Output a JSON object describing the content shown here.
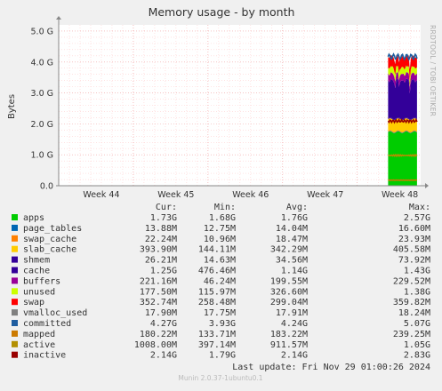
{
  "chart_data": {
    "type": "area",
    "title": "Memory usage - by month",
    "ylabel": "Bytes",
    "side_label": "RRDTOOL / TOBI OETIKER",
    "ylim": [
      0,
      5.2
    ],
    "y_ticks": [
      {
        "value": 0,
        "label": "0.0"
      },
      {
        "value": 1,
        "label": "1.0 G"
      },
      {
        "value": 2,
        "label": "2.0 G"
      },
      {
        "value": 3,
        "label": "3.0 G"
      },
      {
        "value": 4,
        "label": "4.0 G"
      },
      {
        "value": 5,
        "label": "5.0 G"
      }
    ],
    "x_ticks": [
      "Week 44",
      "Week 45",
      "Week 46",
      "Week 47",
      "Week 48"
    ],
    "grid": true,
    "data_window_fraction": [
      0.91,
      0.99
    ],
    "stack_avg_gb": [
      {
        "name": "apps",
        "value": 1.73
      },
      {
        "name": "page_tables",
        "value": 0.014
      },
      {
        "name": "swap_cache",
        "value": 0.022
      },
      {
        "name": "slab_cache",
        "value": 0.385
      },
      {
        "name": "shmem",
        "value": 0.026
      },
      {
        "name": "cache",
        "value": 1.25
      },
      {
        "name": "buffers",
        "value": 0.216
      },
      {
        "name": "unused",
        "value": 0.173
      },
      {
        "name": "swap",
        "value": 0.345
      },
      {
        "name": "vmalloc_used",
        "value": 0.017
      }
    ],
    "line_levels_gb": [
      {
        "name": "committed",
        "value": 4.17
      },
      {
        "name": "mapped",
        "value": 0.18
      },
      {
        "name": "active",
        "value": 0.98
      },
      {
        "name": "inactive",
        "value": 2.09
      }
    ],
    "legend_headers": [
      "Cur:",
      "Min:",
      "Avg:",
      "Max:"
    ],
    "series": [
      {
        "name": "apps",
        "color": "#00cc00",
        "cur": "1.73G",
        "min": "1.68G",
        "avg": "1.76G",
        "max": "2.57G"
      },
      {
        "name": "page_tables",
        "color": "#0066b3",
        "cur": "13.88M",
        "min": "12.75M",
        "avg": "14.04M",
        "max": "16.60M"
      },
      {
        "name": "swap_cache",
        "color": "#ff8000",
        "cur": "22.24M",
        "min": "10.96M",
        "avg": "18.47M",
        "max": "23.93M"
      },
      {
        "name": "slab_cache",
        "color": "#ffcc00",
        "cur": "393.90M",
        "min": "144.11M",
        "avg": "342.29M",
        "max": "405.58M"
      },
      {
        "name": "shmem",
        "color": "#330099",
        "cur": "26.21M",
        "min": "14.63M",
        "avg": "34.56M",
        "max": "73.92M"
      },
      {
        "name": "cache",
        "color": "#330099",
        "cur": "1.25G",
        "min": "476.46M",
        "avg": "1.14G",
        "max": "1.43G"
      },
      {
        "name": "buffers",
        "color": "#990099",
        "cur": "221.16M",
        "min": "46.24M",
        "avg": "199.55M",
        "max": "229.52M"
      },
      {
        "name": "unused",
        "color": "#ccff00",
        "cur": "177.50M",
        "min": "115.97M",
        "avg": "326.60M",
        "max": "1.38G"
      },
      {
        "name": "swap",
        "color": "#ff0000",
        "cur": "352.74M",
        "min": "258.48M",
        "avg": "299.04M",
        "max": "359.82M"
      },
      {
        "name": "vmalloc_used",
        "color": "#808080",
        "cur": "17.90M",
        "min": "17.75M",
        "avg": "17.91M",
        "max": "18.24M"
      },
      {
        "name": "committed",
        "color": "#1e5da0",
        "cur": "4.27G",
        "min": "3.93G",
        "avg": "4.24G",
        "max": "5.07G"
      },
      {
        "name": "mapped",
        "color": "#cc7a00",
        "cur": "180.22M",
        "min": "133.71M",
        "avg": "183.22M",
        "max": "239.25M"
      },
      {
        "name": "active",
        "color": "#b38f00",
        "cur": "1008.00M",
        "min": "397.14M",
        "avg": "911.57M",
        "max": "1.05G"
      },
      {
        "name": "inactive",
        "color": "#990000",
        "cur": "2.14G",
        "min": "1.79G",
        "avg": "2.14G",
        "max": "2.83G"
      }
    ],
    "last_update": "Last update: Fri Nov 29 01:00:26 2024",
    "footer": "Munin 2.0.37-1ubuntu0.1"
  }
}
